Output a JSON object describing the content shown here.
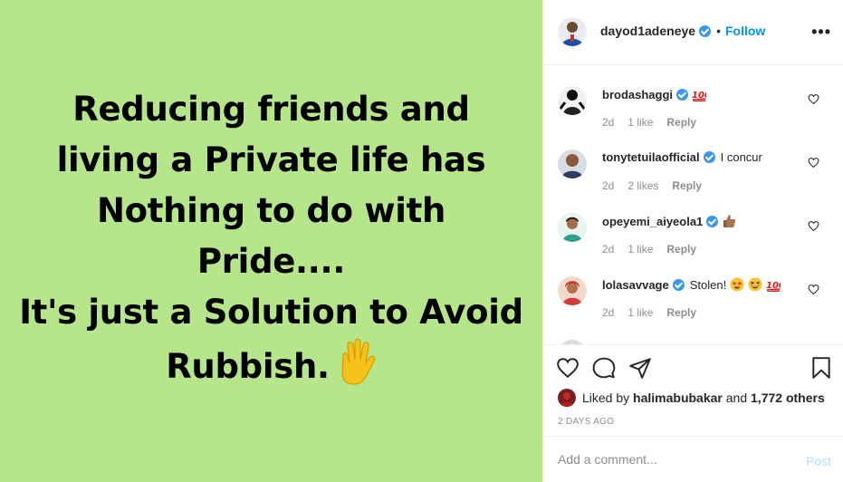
{
  "post": {
    "lines": [
      "Reducing friends and",
      "living a Private life has",
      "Nothing to do with",
      "Pride....",
      "It's just a Solution to Avoid",
      "Rubbish."
    ],
    "emoji": "raised-hand-icon",
    "background": "#b5e68a"
  },
  "header": {
    "username": "dayod1adeneye",
    "separator": "•",
    "follow_label": "Follow",
    "more_label": "•••"
  },
  "comments": [
    {
      "username": "brodashaggi",
      "text": "",
      "emoji": "hundred-points-icon",
      "age": "2d",
      "likes": "1 like",
      "reply": "Reply"
    },
    {
      "username": "tonytetuilaofficial",
      "text": "I concur",
      "age": "2d",
      "likes": "2 likes",
      "reply": "Reply"
    },
    {
      "username": "opeyemi_aiyeola1",
      "text": "",
      "emoji": "thumbs-up-icon",
      "age": "2d",
      "likes": "1 like",
      "reply": "Reply"
    },
    {
      "username": "lolasavvage",
      "text": "Stolen!",
      "emoji": "star-struck-grinning-hundred-icons",
      "age": "2d",
      "likes": "1 like",
      "reply": "Reply"
    }
  ],
  "actions": {
    "liked_by_prefix": "Liked by",
    "liked_by_user": "halimabubakar",
    "liked_by_and": "and",
    "liked_by_others": "1,772 others",
    "timestamp": "2 DAYS AGO"
  },
  "add_comment": {
    "placeholder": "Add a comment...",
    "post_label": "Post"
  },
  "colors": {
    "accent": "#0095f6",
    "verified": "#3897f0",
    "post_disabled": "#b2dffc"
  }
}
